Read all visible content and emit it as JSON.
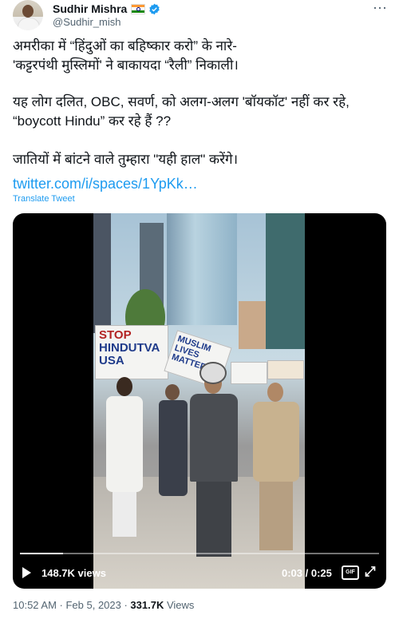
{
  "author": {
    "name": "Sudhir Mishra",
    "handle": "@Sudhir_mish",
    "badge_color": "#1d9bf0"
  },
  "tweet": {
    "line1": "अमरीका में “हिंदुओं का बहिष्कार करो”  के नारे-",
    "line2": "'कट्टरपंथी मुस्लिमों' ने बाकायदा “रैली” निकाली।",
    "para2": "यह लोग दलित, OBC, सवर्ण, को अलग-अलग 'बॉयकॉट' नहीं कर रहे, “boycott Hindu” कर रहे हैं ??",
    "para3": "जातियों में बांटने वाले तुम्हारा \"यही हाल\" करेंगे।",
    "link": "twitter.com/i/spaces/1YpKk…",
    "translate": "Translate Tweet"
  },
  "video": {
    "sign_stop": "STOP",
    "sign_hindutva": "HINDUTVA",
    "sign_usa": "USA",
    "sign_muslim": "MUSLIM LIVES MATTER",
    "views": "148.7K views",
    "time": "0:03 / 0:25",
    "progress": 0.12,
    "gif_label": "GIF"
  },
  "meta": {
    "time_date": "10:52 AM · Feb 5, 2023 · ",
    "views_count": "331.7K",
    "views_label": " Views"
  }
}
